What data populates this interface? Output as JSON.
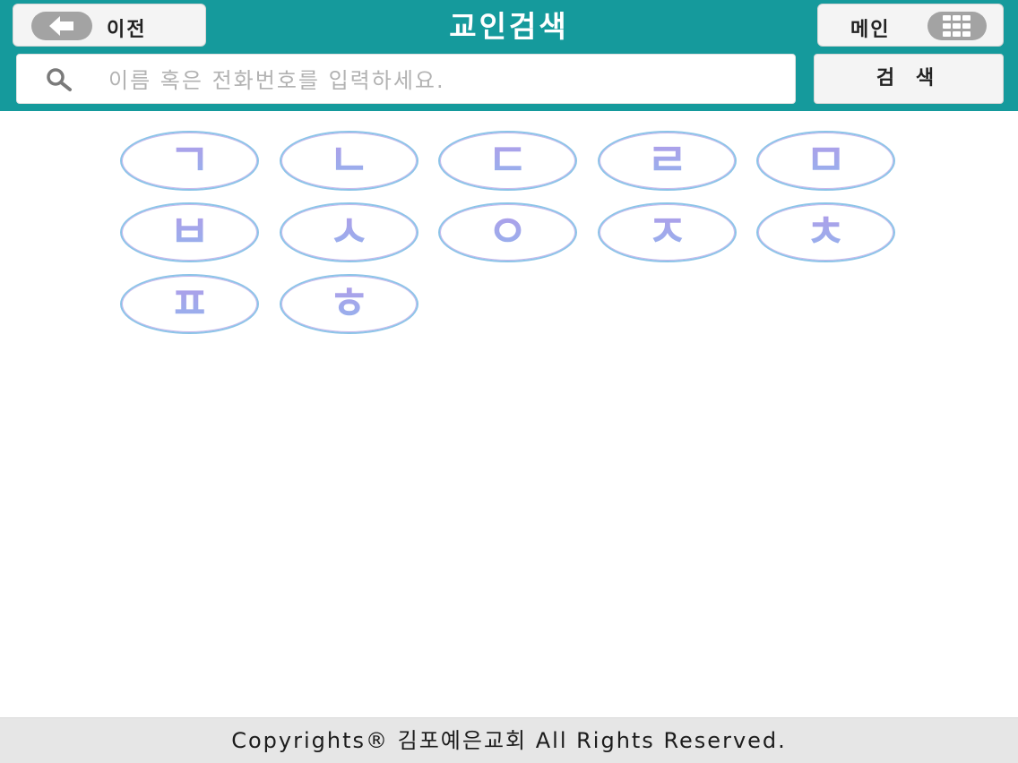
{
  "header": {
    "back_label": "이전",
    "title": "교인검색",
    "main_label": "메인",
    "back_icon": "arrow-left-icon",
    "main_icon": "grid-menu-icon",
    "bg_color": "#159a9c"
  },
  "search": {
    "placeholder": "이름 혹은 전화번호를 입력하세요.",
    "value": "",
    "button_label": "검 색",
    "icon": "search-icon"
  },
  "consonants": [
    "ㄱ",
    "ㄴ",
    "ㄷ",
    "ㄹ",
    "ㅁ",
    "ㅂ",
    "ㅅ",
    "ㅇ",
    "ㅈ",
    "ㅊ",
    "ㅍ",
    "ㅎ"
  ],
  "footer": {
    "copyright": "Copyrights® 김포예은교회 All Rights Reserved."
  }
}
